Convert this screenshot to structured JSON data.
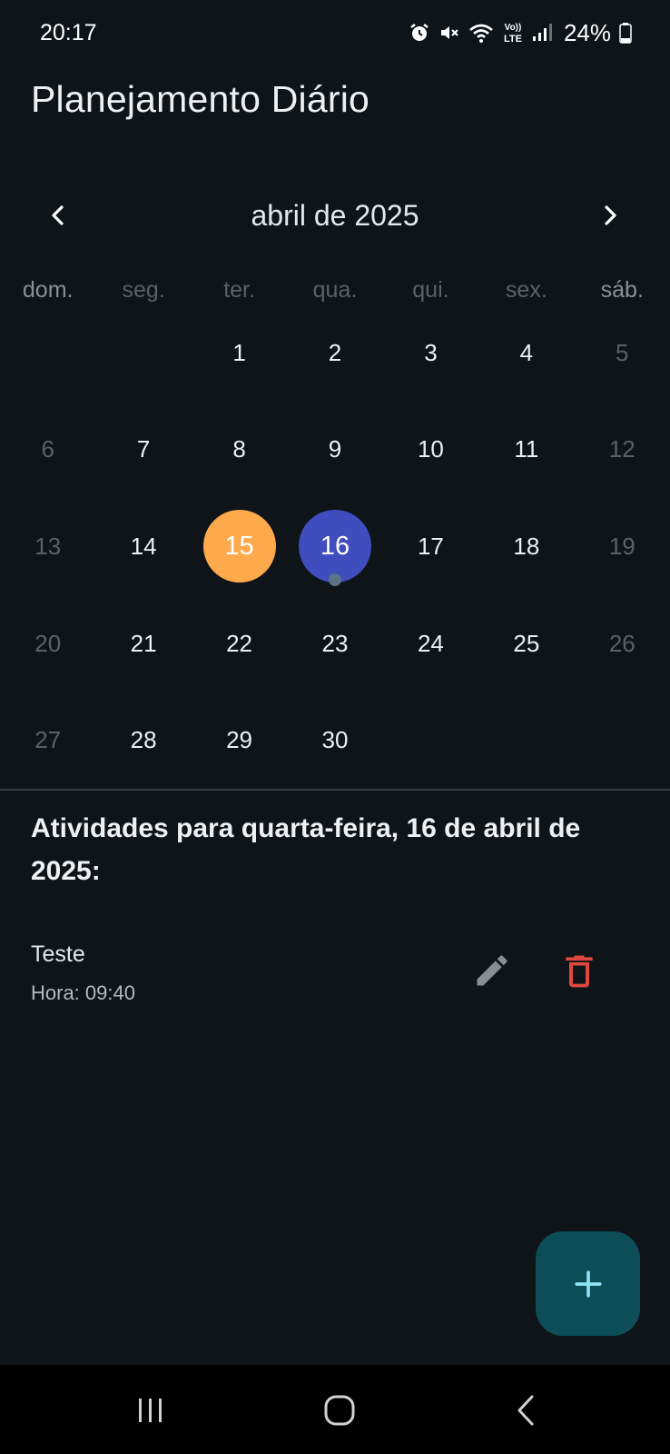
{
  "status_bar": {
    "time": "20:17",
    "battery": "24%",
    "icons": [
      "alarm-icon",
      "mute-icon",
      "wifi-icon",
      "volte-icon",
      "signal-icon",
      "battery-icon"
    ],
    "lte_top": "Vo))",
    "lte_bottom": "LTE"
  },
  "app": {
    "title": "Planejamento Diário"
  },
  "calendar": {
    "month_label": "abril de 2025",
    "weekdays": [
      "dom.",
      "seg.",
      "ter.",
      "qua.",
      "qui.",
      "sex.",
      "sáb."
    ],
    "leading_blanks": 2,
    "days_in_month": 30,
    "today": 15,
    "selected": 16,
    "event_days": [
      16
    ],
    "colors": {
      "today": "#ffa94d",
      "selected": "#3f4dbf",
      "event_marker": "#5b7386"
    }
  },
  "activities": {
    "title": "Atividades para quarta-feira, 16 de abril de 2025:",
    "items": [
      {
        "name": "Teste",
        "time": "Hora: 09:40"
      }
    ]
  },
  "colors": {
    "delete": "#e0483f",
    "edit": "#8a8f94",
    "fab_bg": "#0c4d57",
    "fab_icon": "#8ee4f2"
  }
}
